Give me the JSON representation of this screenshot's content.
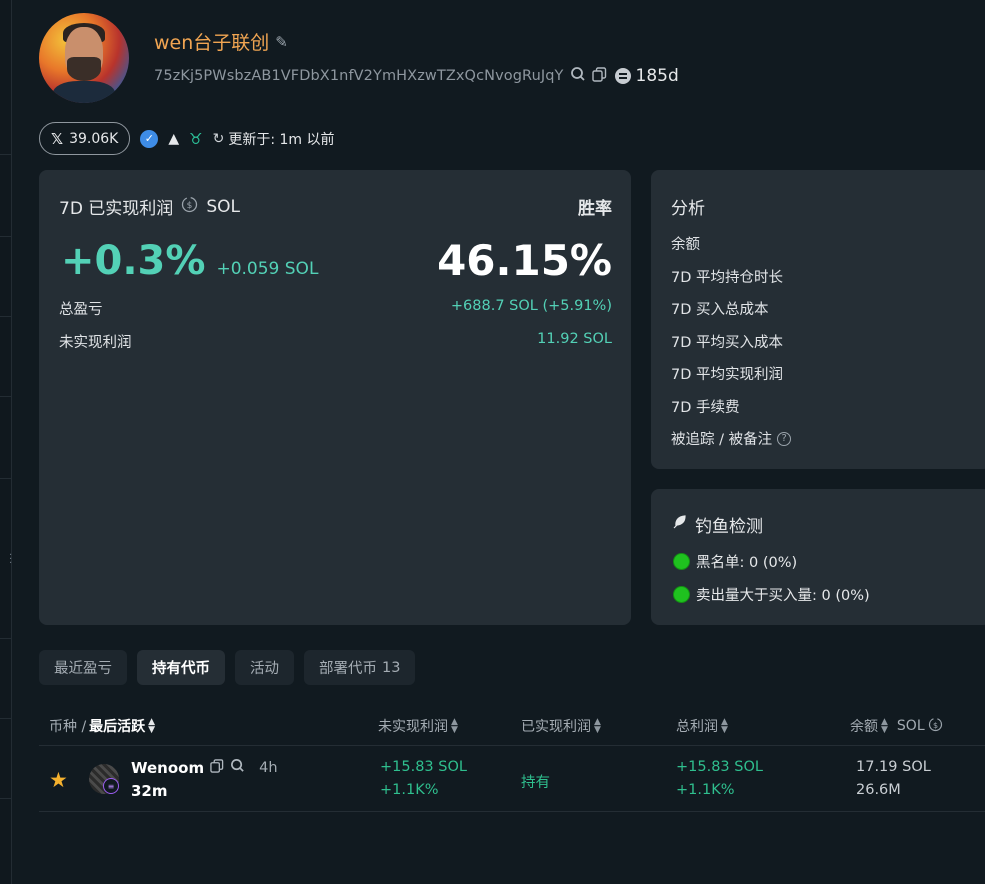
{
  "profile": {
    "name": "wen台子联创",
    "address": "75zKj5PWsbzAB1VFDbX1nfV2YmHXzwTZxQcNvogRuJqY",
    "age": "185d",
    "twitter_followers": "39.06K",
    "updated_label": "更新于: 1m 以前"
  },
  "pnl": {
    "title": "7D 已实现利润",
    "currency": "SOL",
    "winrate_label": "胜率",
    "pct": "+0.3%",
    "sol": "+0.059 SOL",
    "winrate": "46.15%",
    "rows": [
      {
        "label": "总盈亏",
        "value": "+688.7 SOL (+5.91%)"
      },
      {
        "label": "未实现利润",
        "value": "11.92 SOL"
      }
    ]
  },
  "analysis": {
    "title": "分析",
    "items": [
      "余额",
      "7D 平均持仓时长",
      "7D 买入总成本",
      "7D 平均买入成本",
      "7D 平均实现利润",
      "7D 手续费",
      "被追踪 / 被备注"
    ]
  },
  "phishing": {
    "title": "钓鱼检测",
    "items": [
      "黑名单: 0 (0%)",
      "卖出量大于买入量: 0 (0%)"
    ]
  },
  "tabs": [
    {
      "label": "最近盈亏"
    },
    {
      "label": "持有代币"
    },
    {
      "label": "活动"
    },
    {
      "label": "部署代币",
      "count": "13"
    }
  ],
  "table": {
    "headers": {
      "token": "币种 /",
      "last_active": "最后活跃",
      "unrealized": "未实现利润",
      "realized": "已实现利润",
      "total": "总利润",
      "balance": "余额",
      "balance_unit": "SOL"
    },
    "rows": [
      {
        "name": "Wenoom",
        "age": "4h",
        "last_active": "32m",
        "unrealized_sol": "+15.83 SOL",
        "unrealized_pct": "+1.1K%",
        "realized": "持有",
        "total_sol": "+15.83 SOL",
        "total_pct": "+1.1K%",
        "balance_sol": "17.19 SOL",
        "balance_amt": "26.6M"
      }
    ]
  },
  "colors": {
    "accent_green": "#53d1b6",
    "name_orange": "#f1a552",
    "card_bg": "#252e35",
    "page_bg": "#111a20"
  }
}
